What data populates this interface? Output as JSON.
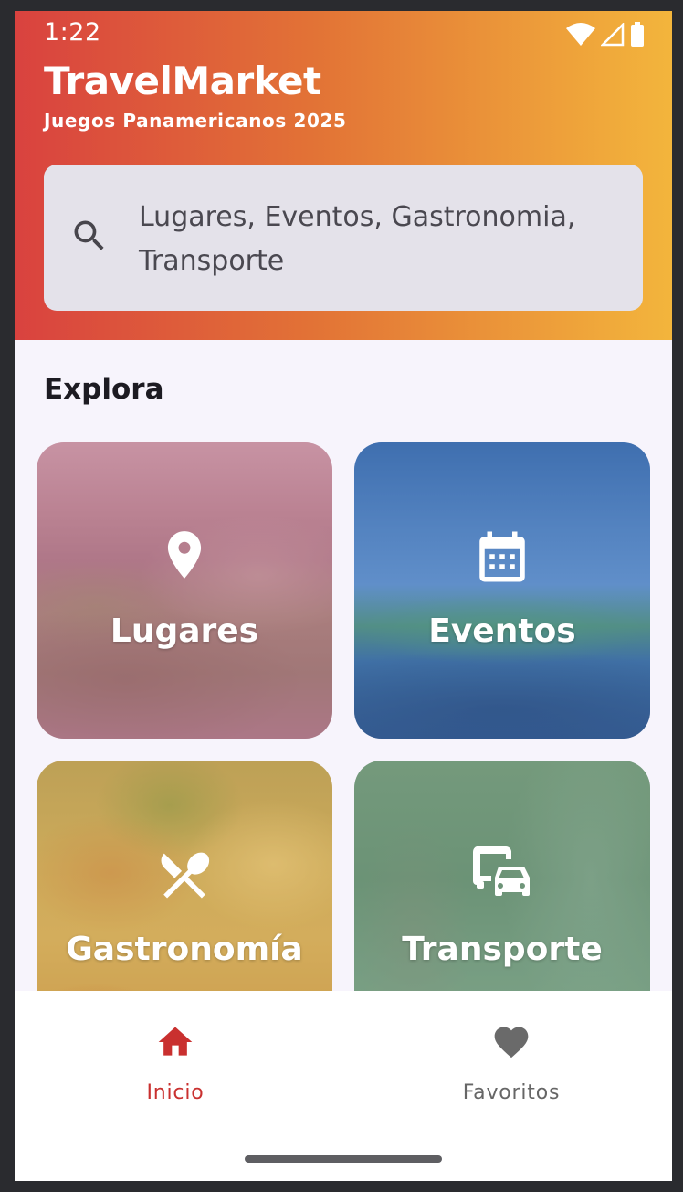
{
  "status_bar": {
    "time": "1:22",
    "icons": [
      "wifi-icon",
      "signal-icon",
      "battery-icon"
    ]
  },
  "header": {
    "title": "TravelMarket",
    "subtitle": "Juegos Panamericanos 2025",
    "gradient_colors": [
      "#d9423f",
      "#e27236",
      "#f3b53c"
    ]
  },
  "search": {
    "placeholder": "Lugares, Eventos, Gastronomia, Transporte",
    "icon": "search-icon"
  },
  "explore": {
    "title": "Explora",
    "cards": [
      {
        "label": "Lugares",
        "icon": "location-pin-icon"
      },
      {
        "label": "Eventos",
        "icon": "calendar-icon"
      },
      {
        "label": "Gastronomía",
        "icon": "utensils-icon"
      },
      {
        "label": "Transporte",
        "icon": "bus-car-icon"
      }
    ]
  },
  "bottom_nav": {
    "items": [
      {
        "label": "Inicio",
        "icon": "home-icon",
        "active": true
      },
      {
        "label": "Favoritos",
        "icon": "heart-icon",
        "active": false
      }
    ],
    "active_color": "#c9302f",
    "inactive_color": "#666666"
  }
}
